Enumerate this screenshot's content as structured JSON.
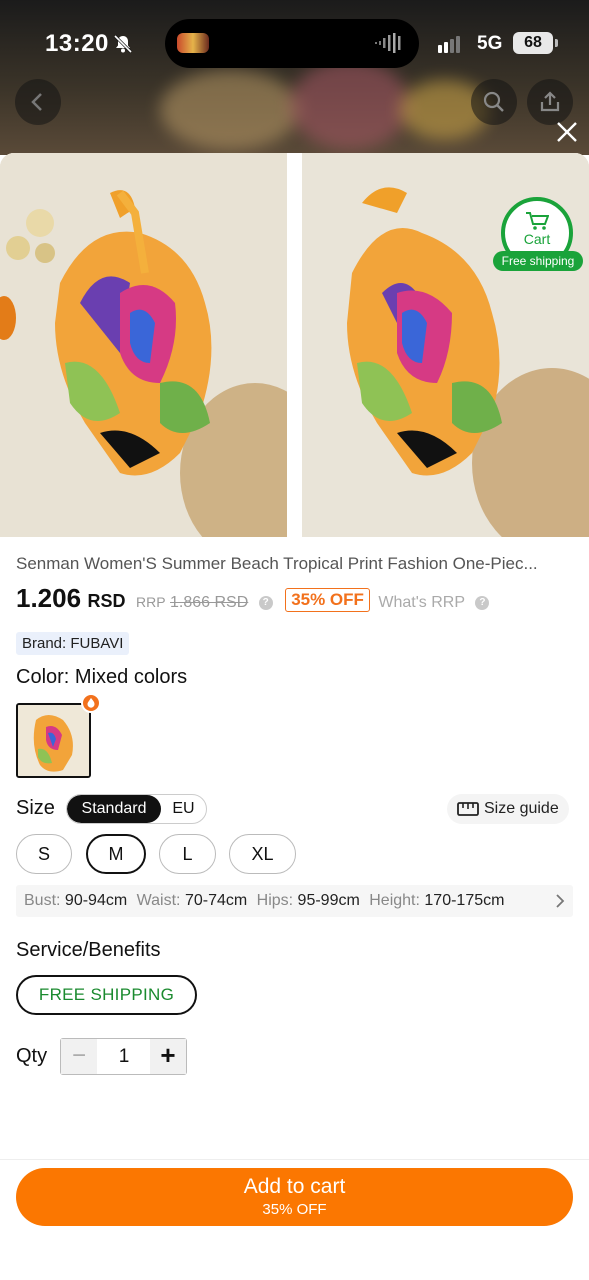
{
  "status_bar": {
    "time": "13:20",
    "network": "5G",
    "battery": "68"
  },
  "header": {
    "back_icon": "chevron-left-icon",
    "search_icon": "search-icon",
    "share_icon": "share-icon",
    "close_icon": "close-icon"
  },
  "gallery": {
    "cart_badge": {
      "label": "Cart",
      "sub": "Free shipping"
    }
  },
  "product": {
    "title": "Senman Women'S Summer Beach Tropical Print Fashion One-Piec...",
    "price": "1.206",
    "currency": "RSD",
    "rrp_label": "RRP",
    "rrp_value": "1.866 RSD",
    "discount": "35% OFF",
    "whats_rrp": "What's RRP",
    "brand": "Brand: FUBAVI"
  },
  "color": {
    "label": "Color: Mixed colors"
  },
  "size": {
    "label": "Size",
    "toggle": [
      "Standard",
      "EU"
    ],
    "guide": "Size guide",
    "options": [
      "S",
      "M",
      "L",
      "XL"
    ],
    "selected": "M",
    "measurements": [
      {
        "key": "Bust:",
        "value": "90-94cm"
      },
      {
        "key": "Waist:",
        "value": "70-74cm"
      },
      {
        "key": "Hips:",
        "value": "95-99cm"
      },
      {
        "key": "Height:",
        "value": "170-175cm"
      }
    ]
  },
  "service": {
    "label": "Service/Benefits",
    "badge": "FREE SHIPPING"
  },
  "quantity": {
    "label": "Qty",
    "value": "1",
    "minus": "−",
    "plus": "+"
  },
  "cta": {
    "label": "Add to cart",
    "sub": "35% OFF"
  },
  "colors": {
    "accent": "#fb7701",
    "discount": "#f2711c",
    "green": "#1aa33a"
  }
}
